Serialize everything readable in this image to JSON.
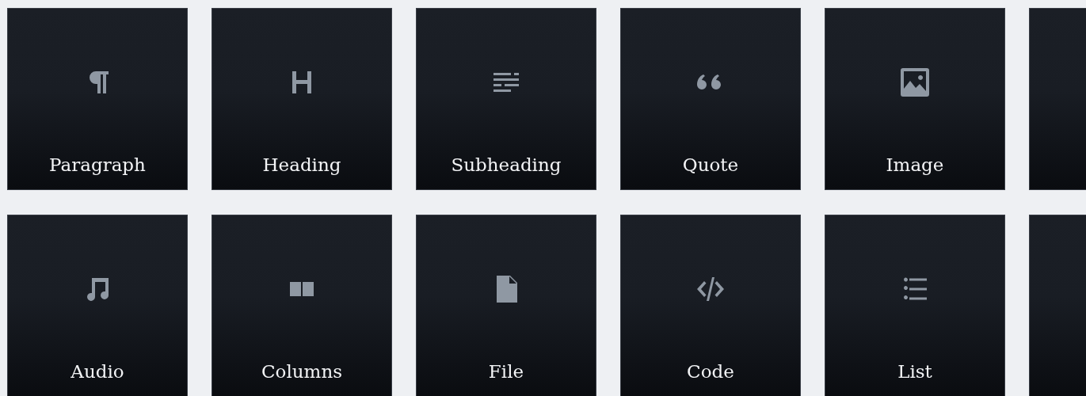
{
  "blocks": [
    [
      {
        "kind": "paragraph",
        "label": "Paragraph"
      },
      {
        "kind": "heading",
        "label": "Heading"
      },
      {
        "kind": "subheading",
        "label": "Subheading"
      },
      {
        "kind": "quote",
        "label": "Quote"
      },
      {
        "kind": "image",
        "label": "Image"
      },
      {
        "kind": "partial"
      }
    ],
    [
      {
        "kind": "audio",
        "label": "Audio"
      },
      {
        "kind": "columns",
        "label": "Columns"
      },
      {
        "kind": "file",
        "label": "File"
      },
      {
        "kind": "code",
        "label": "Code"
      },
      {
        "kind": "list",
        "label": "List"
      },
      {
        "kind": "partial"
      }
    ]
  ]
}
